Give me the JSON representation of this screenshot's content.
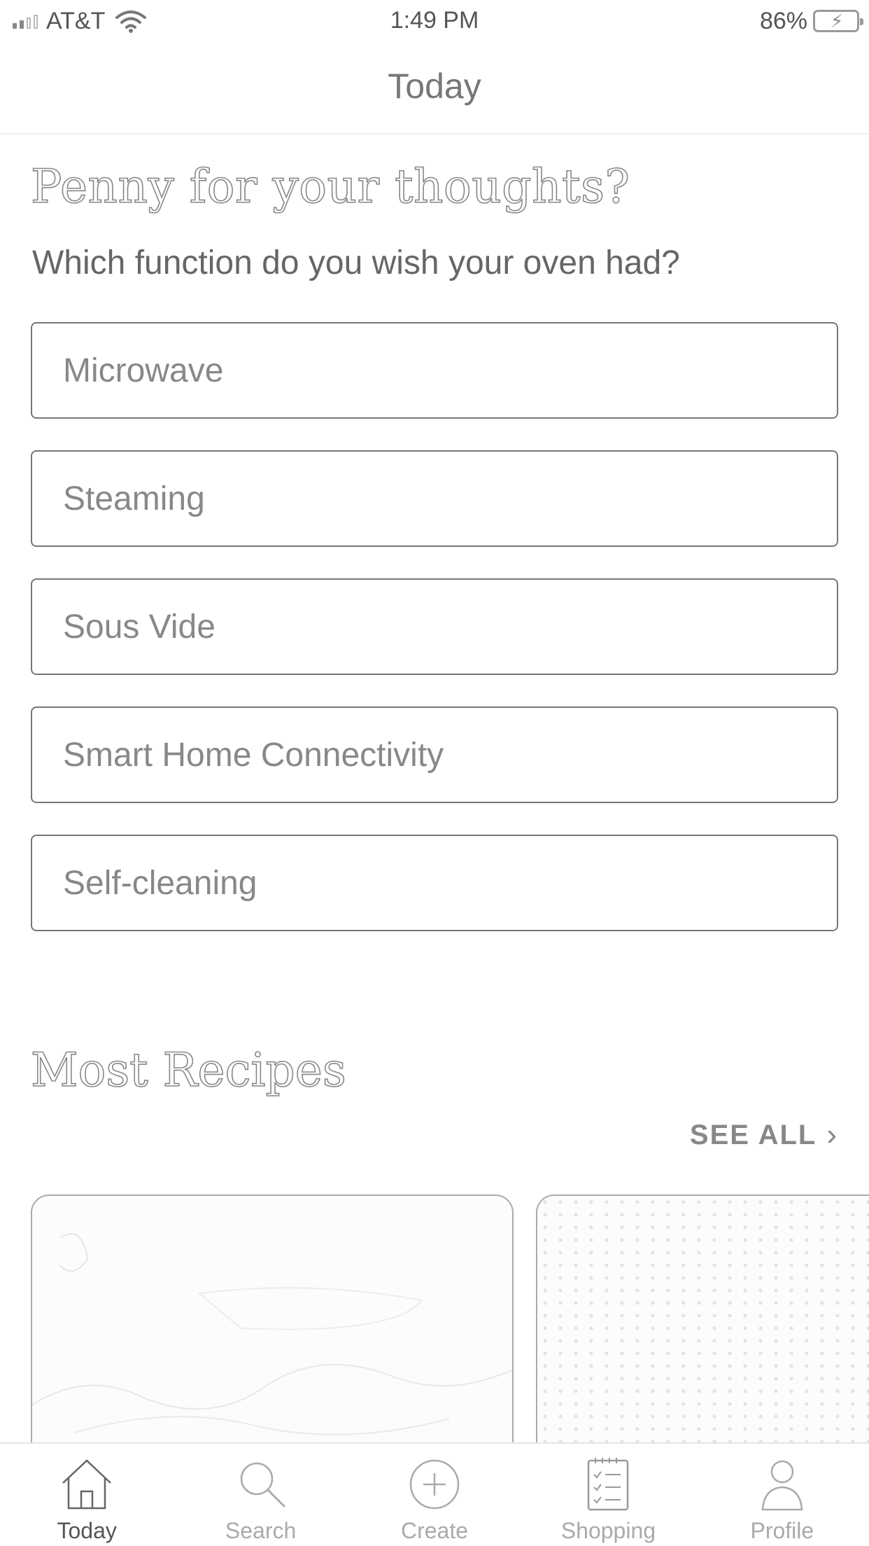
{
  "status_bar": {
    "carrier": "AT&T",
    "time": "1:49 PM",
    "battery": "86%"
  },
  "nav": {
    "title": "Today"
  },
  "poll": {
    "title": "Penny for your thoughts?",
    "question": "Which function do you wish your oven had?",
    "options": [
      "Microwave",
      "Steaming",
      "Sous Vide",
      "Smart Home Connectivity",
      "Self-cleaning"
    ]
  },
  "recipes": {
    "title": "Most Recipes",
    "see_all": "SEE ALL"
  },
  "tabs": [
    {
      "label": "Today",
      "icon": "home-icon",
      "active": true
    },
    {
      "label": "Search",
      "icon": "search-icon",
      "active": false
    },
    {
      "label": "Create",
      "icon": "plus-circle-icon",
      "active": false
    },
    {
      "label": "Shopping",
      "icon": "checklist-icon",
      "active": false
    },
    {
      "label": "Profile",
      "icon": "person-icon",
      "active": false
    }
  ],
  "colors": {
    "text": "#666666",
    "border": "#777777",
    "tab_active": "#555555",
    "tab_inactive": "#aaaaaa"
  }
}
